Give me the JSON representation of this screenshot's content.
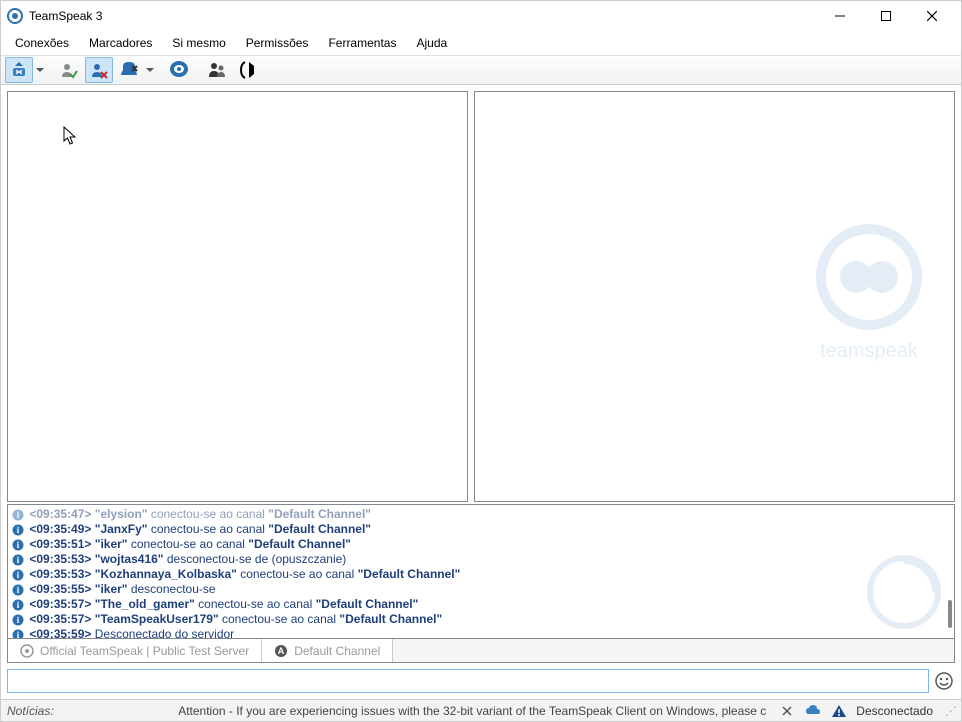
{
  "titlebar": {
    "title": "TeamSpeak 3"
  },
  "menu": {
    "connections": "Conexões",
    "bookmarks": "Marcadores",
    "self": "Si mesmo",
    "permissions": "Permissões",
    "tools": "Ferramentas",
    "help": "Ajuda"
  },
  "log": [
    {
      "ts": "<09:35:47>",
      "user": "elysion",
      "msg1": "conectou-se ao canal",
      "ch": "Default Channel",
      "faded": true
    },
    {
      "ts": "<09:35:49>",
      "user": "JanxFy",
      "msg1": "conectou-se ao canal",
      "ch": "Default Channel"
    },
    {
      "ts": "<09:35:51>",
      "user": "iker",
      "msg1": "conectou-se ao canal",
      "ch": "Default Channel"
    },
    {
      "ts": "<09:35:53>",
      "user": "wojtas416",
      "msg1": "desconectou-se de (opuszczanie)"
    },
    {
      "ts": "<09:35:53>",
      "user": "Kozhannaya_Kolbaska",
      "msg1": "conectou-se ao canal",
      "ch": "Default Channel"
    },
    {
      "ts": "<09:35:55>",
      "user": "iker",
      "msg1": "desconectou-se"
    },
    {
      "ts": "<09:35:57>",
      "user": "The_old_gamer",
      "msg1": "conectou-se ao canal",
      "ch": "Default Channel"
    },
    {
      "ts": "<09:35:57>",
      "user": "TeamSpeakUser179",
      "msg1": "conectou-se ao canal",
      "ch": "Default Channel"
    },
    {
      "ts": "<09:35:59>",
      "msg1": "Desconectado do servidor"
    }
  ],
  "tabs": {
    "server": "Official TeamSpeak | Public Test Server",
    "channel": "Default Channel"
  },
  "chat": {
    "value": ""
  },
  "status": {
    "label": "Notícias:",
    "ticker": "Attention - If you are experiencing issues with the 32-bit variant of the TeamSpeak Client on Windows, please c",
    "state": "Desconectado"
  }
}
